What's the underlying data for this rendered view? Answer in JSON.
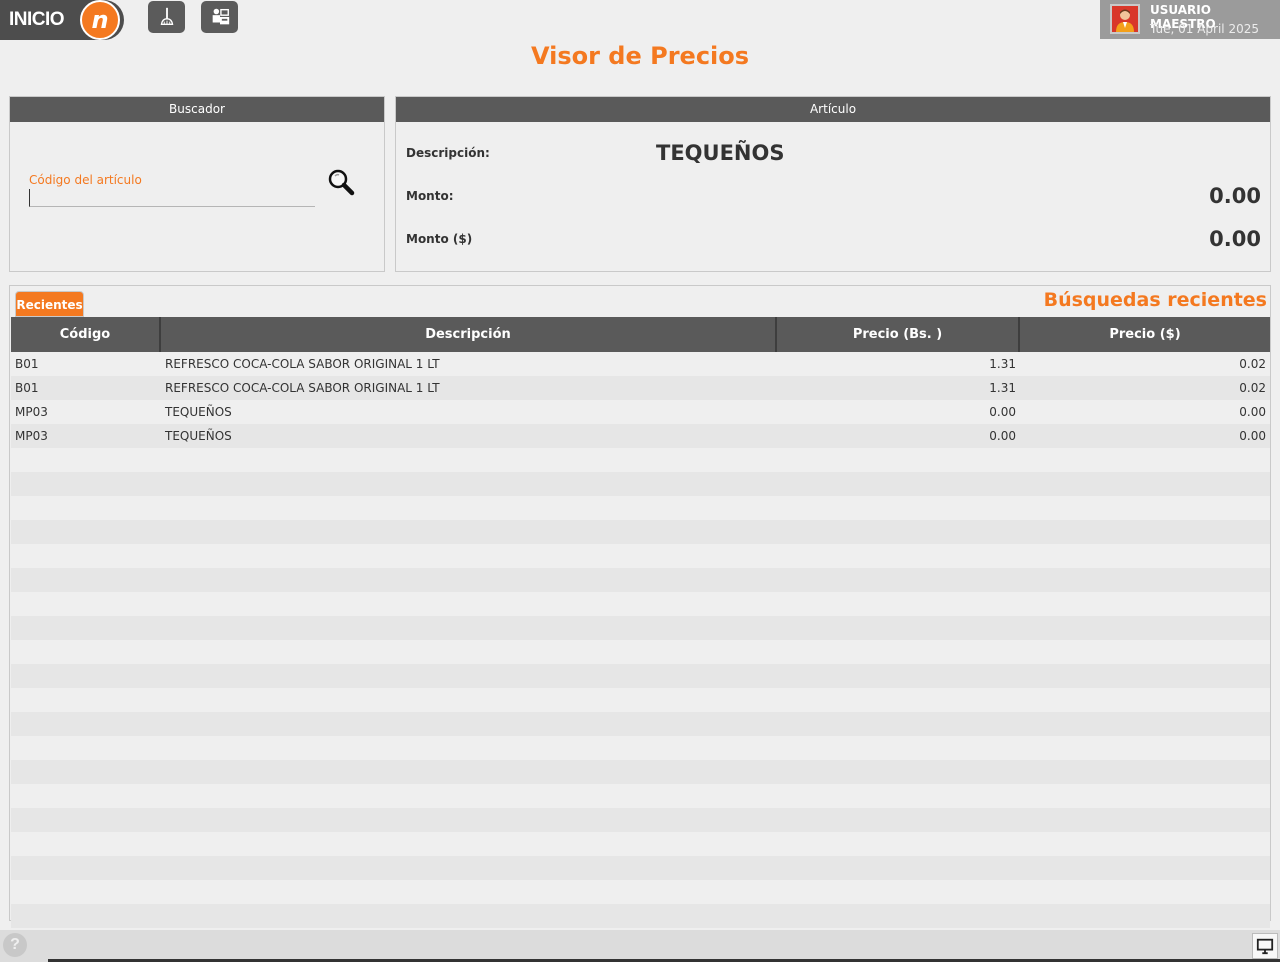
{
  "header": {
    "brand_text": "INICIO",
    "brand_logo_letter": "n",
    "tools": [
      {
        "icon": "cleaning-broom-icon"
      },
      {
        "icon": "cashier-icon"
      }
    ],
    "user": {
      "name": "USUARIO MAESTRO",
      "date": "Tue, 01 April 2025",
      "avatar_icon": "user-avatar-icon"
    }
  },
  "page_title": "Visor de Precios",
  "search": {
    "header": "Buscador",
    "field_label": "Código del artículo",
    "field_value": "",
    "search_icon": "magnifier-icon"
  },
  "article": {
    "header": "Artículo",
    "description_label": "Descripción:",
    "description_value": "TEQUEÑOS",
    "amount_label": "Monto:",
    "amount_value": "0.00",
    "amount_usd_label": "Monto ($)",
    "amount_usd_value": "0.00"
  },
  "recent": {
    "tab_label": "Recientes",
    "title": "Búsquedas recientes",
    "columns": [
      "Código",
      "Descripción",
      "Precio (Bs. )",
      "Precio ($)"
    ],
    "rows": [
      {
        "code": "B01",
        "description": "REFRESCO COCA-COLA SABOR ORIGINAL 1 LT",
        "price_bs": "1.31",
        "price_usd": "0.02"
      },
      {
        "code": "B01",
        "description": "REFRESCO COCA-COLA SABOR ORIGINAL 1 LT",
        "price_bs": "1.31",
        "price_usd": "0.02"
      },
      {
        "code": "MP03",
        "description": "TEQUEÑOS",
        "price_bs": "0.00",
        "price_usd": "0.00"
      },
      {
        "code": "MP03",
        "description": "TEQUEÑOS",
        "price_bs": "0.00",
        "price_usd": "0.00"
      }
    ]
  },
  "footer": {
    "help_label": "?",
    "help_icon": "help-icon",
    "screen_icon": "monitor-icon"
  },
  "colors": {
    "accent": "#f47920",
    "header_dark": "#5a5a5a"
  }
}
